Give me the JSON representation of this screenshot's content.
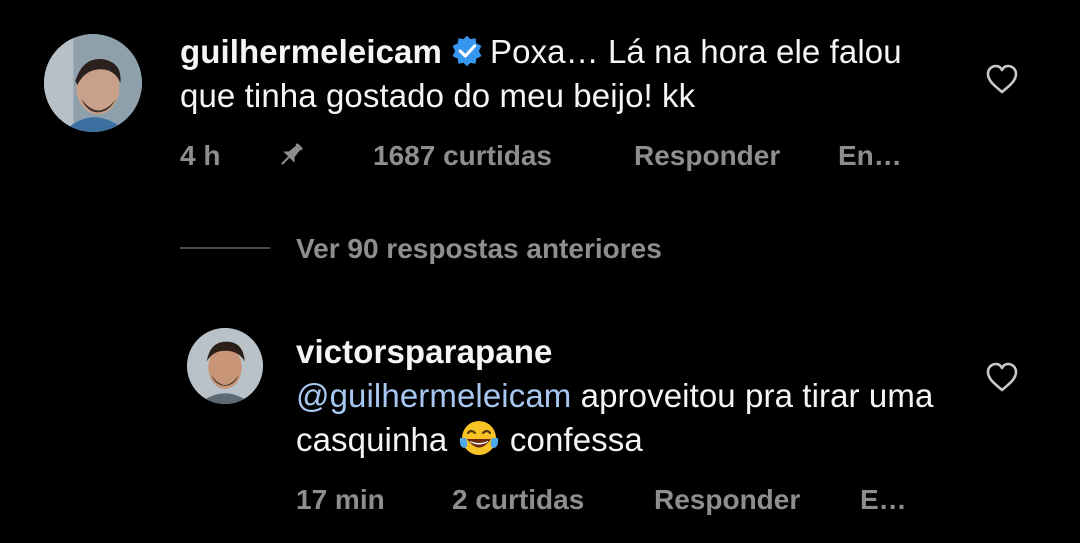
{
  "comment1": {
    "username": "guilhermeleicam",
    "verified": true,
    "text": "Poxa… Lá na hora ele falou que tinha gostado do meu beijo! kk",
    "time": "4 h",
    "likes": "1687 curtidas",
    "reply": "Responder",
    "more": "En…",
    "icons": [
      "pin-icon",
      "heart-icon",
      "verified-badge-icon"
    ]
  },
  "view_replies": {
    "label": "Ver 90 respostas anteriores"
  },
  "comment2": {
    "username": "victorsparapane",
    "mention": "@guilhermeleicam",
    "text_part1": "aproveitou pra tirar uma casquinha",
    "emoji": "😂",
    "text_part2": "confessa",
    "time": "17 min",
    "likes": "2 curtidas",
    "reply": "Responder",
    "more": "E…",
    "icons": [
      "heart-icon"
    ]
  },
  "colors": {
    "background": "#000000",
    "text": "#f5f5f5",
    "muted": "#8e8e8e",
    "mention": "#a8c7f0",
    "verified": "#3797f0"
  }
}
